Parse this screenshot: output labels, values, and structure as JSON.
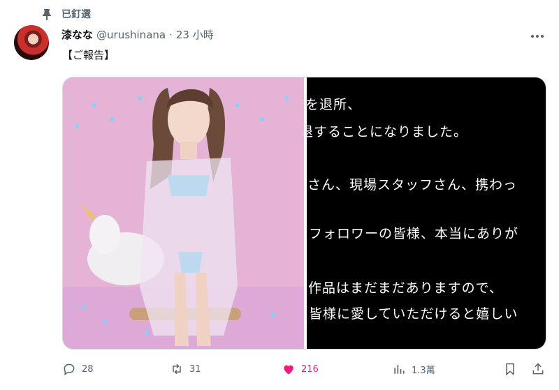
{
  "pinned": {
    "icon": "pin-icon",
    "label": "已釘選"
  },
  "author": {
    "name": "漆なな",
    "handle": "@urushinana",
    "separator": "·",
    "time": "23 小時"
  },
  "tweet": {
    "text": "【ご報告】"
  },
  "media": {
    "announcement_lines": [
      "を退所、",
      "退することになりました。",
      "さん、現場スタッフさん、携わっ",
      "フォロワーの皆様、本当にありが",
      "作品はまだまだありますので、",
      "皆様に愛していただけると嬉しい"
    ]
  },
  "actions": {
    "reply_count": "28",
    "retweet_count": "31",
    "like_count": "216",
    "views_count": "1.3萬"
  },
  "colors": {
    "like": "#f91880",
    "muted": "#536471",
    "text": "#0f1419"
  }
}
